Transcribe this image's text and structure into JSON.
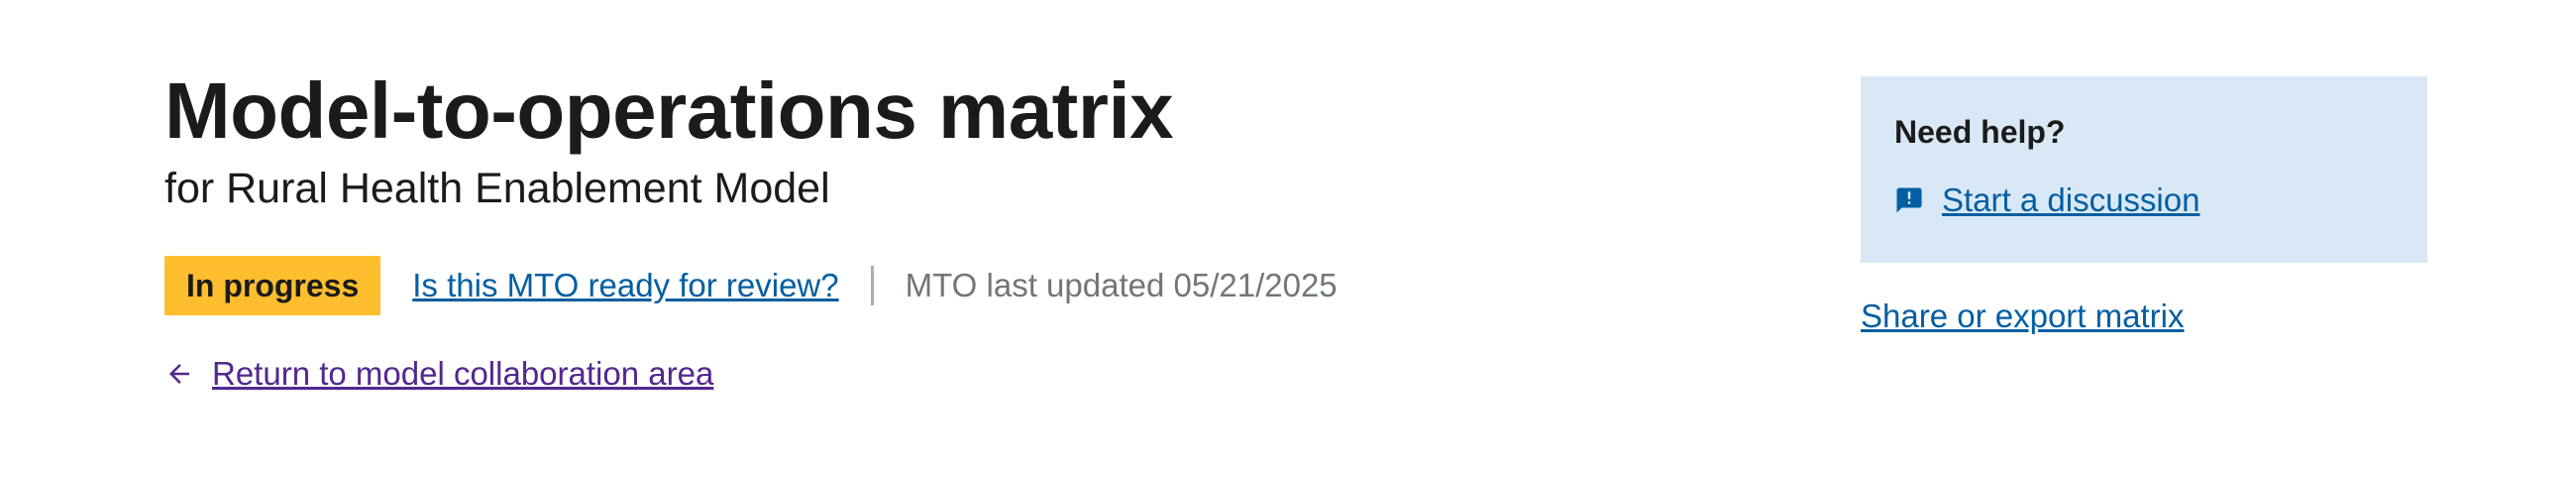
{
  "header": {
    "title": "Model-to-operations matrix",
    "subtitle": "for Rural Health Enablement Model"
  },
  "status": {
    "badge_label": "In progress",
    "review_link_label": "Is this MTO ready for review?",
    "last_updated": "MTO last updated 05/21/2025"
  },
  "navigation": {
    "return_label": "Return to model collaboration area",
    "return_icon": "arrow-left-icon"
  },
  "help": {
    "title": "Need help?",
    "discussion_label": "Start a discussion",
    "discussion_icon": "announcement-icon"
  },
  "actions": {
    "share_label": "Share or export matrix"
  },
  "colors": {
    "badge_background": "#ffbe2e",
    "link_blue": "#005ea2",
    "visited_purple": "#54278f",
    "help_background": "#d9e8f6",
    "muted_text": "#71767a"
  }
}
